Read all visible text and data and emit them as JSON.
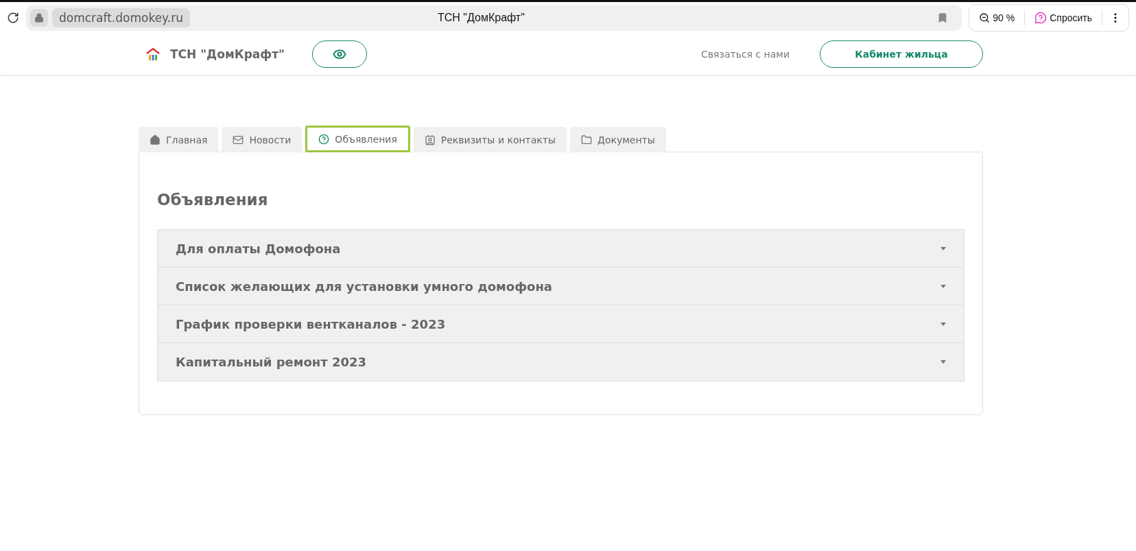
{
  "browser": {
    "url": "domcraft.domokey.ru",
    "title": "ТСН \"ДомКрафт\"",
    "zoom": "90 %",
    "ask": "Спросить"
  },
  "header": {
    "brand": "ТСН \"ДомКрафт\"",
    "contact": "Связаться с нами",
    "cabinet": "Кабинет жильца"
  },
  "tabs": [
    {
      "label": "Главная",
      "selected": false
    },
    {
      "label": "Новости",
      "selected": false
    },
    {
      "label": "Объявления",
      "selected": true
    },
    {
      "label": "Реквизиты и контакты",
      "selected": false
    },
    {
      "label": "Документы",
      "selected": false
    }
  ],
  "section": {
    "title": "Объявления"
  },
  "announcements": [
    {
      "title": "Для оплаты Домофона",
      "expanded": false
    },
    {
      "title": "Список желающих для установки умного домофона",
      "expanded": false
    },
    {
      "title": "График проверки вентканалов - 2023",
      "expanded": false
    },
    {
      "title": "Капитальный ремонт 2023",
      "expanded": false
    }
  ]
}
